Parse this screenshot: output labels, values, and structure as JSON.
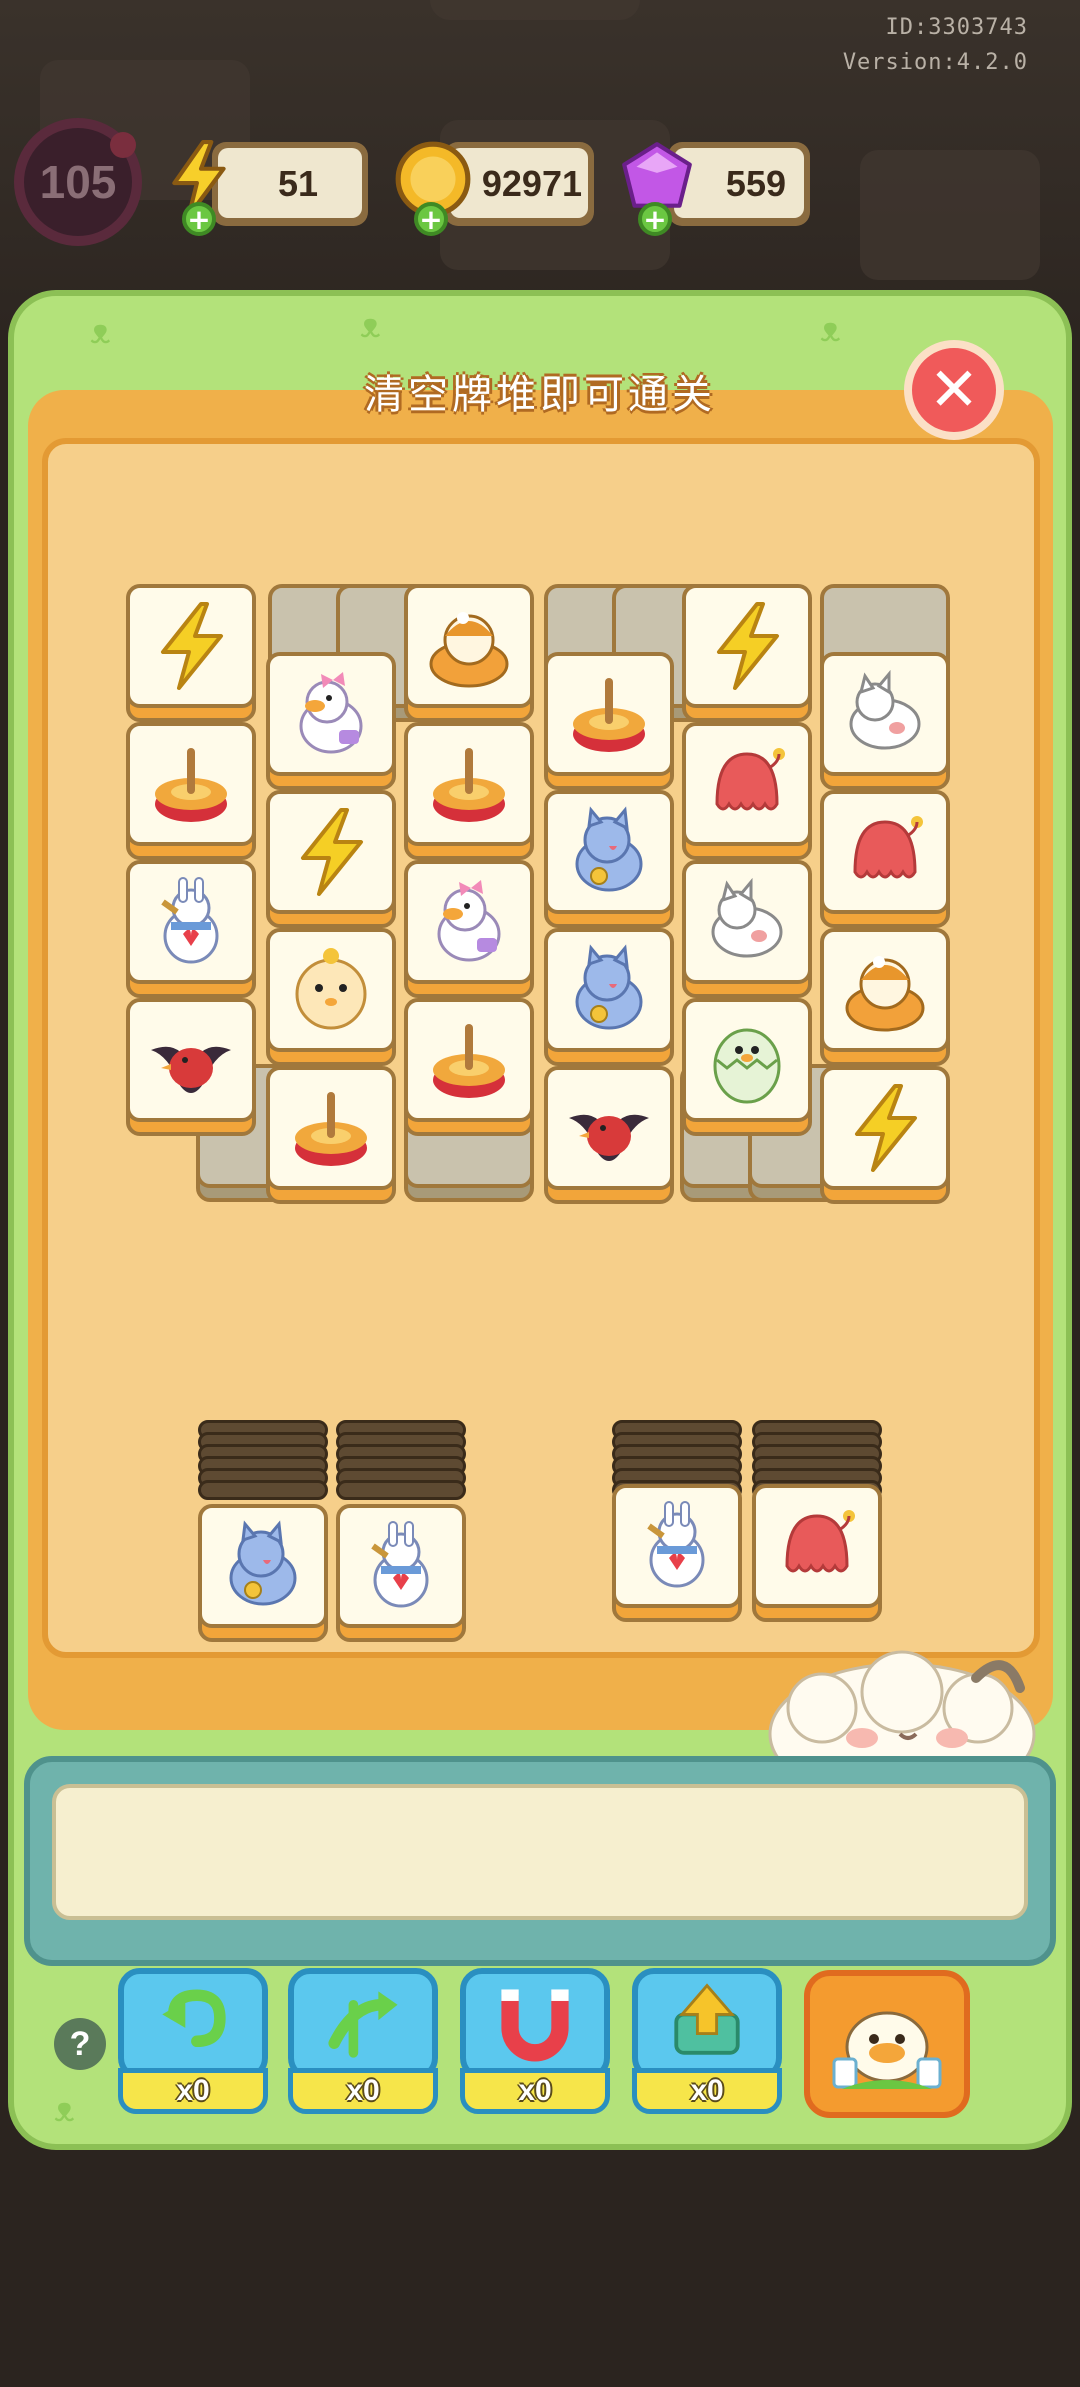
{
  "meta": {
    "id": "ID:3303743",
    "version": "Version:4.2.0"
  },
  "hud": {
    "level": "105",
    "energy": {
      "value": "51",
      "icon": "lightning-bolt-icon"
    },
    "coins": {
      "value": "92971",
      "icon": "coin-icon"
    },
    "gems": {
      "value": "559",
      "icon": "purple-gem-icon"
    }
  },
  "board": {
    "title": "清空牌堆即可通关",
    "close_icon": "close-icon"
  },
  "tiles": [
    {
      "icon": "lightning-icon",
      "dim": false
    },
    {
      "icon": "duck-bow-icon",
      "dim": false
    },
    {
      "icon": "bun-cat-icon",
      "dim": false
    },
    {
      "icon": "spinning-top-icon",
      "dim": false
    },
    {
      "icon": "lightning-icon",
      "dim": false
    },
    {
      "icon": "white-cat-icon",
      "dim": false
    },
    {
      "icon": "spinning-top-icon",
      "dim": false
    },
    {
      "icon": "spinning-top-icon",
      "dim": false
    },
    {
      "icon": "blue-cat-icon",
      "dim": false
    },
    {
      "icon": "red-octopus-icon",
      "dim": false
    },
    {
      "icon": "red-octopus-icon",
      "dim": false
    },
    {
      "icon": "lightning-icon",
      "dim": false
    },
    {
      "icon": "rabbit-heart-icon",
      "dim": false
    },
    {
      "icon": "duck-bow-icon",
      "dim": false
    },
    {
      "icon": "blue-cat-icon",
      "dim": false
    },
    {
      "icon": "white-cat-icon",
      "dim": false
    },
    {
      "icon": "bun-cat-icon",
      "dim": false
    },
    {
      "icon": "pufferfish-icon",
      "dim": false
    },
    {
      "icon": "red-bird-icon",
      "dim": false
    },
    {
      "icon": "spinning-top-icon",
      "dim": false
    },
    {
      "icon": "egg-chick-icon",
      "dim": false
    },
    {
      "icon": "spinning-top-icon",
      "dim": false
    },
    {
      "icon": "red-bird-icon",
      "dim": false
    },
    {
      "icon": "lightning-icon",
      "dim": false
    }
  ],
  "stacks": [
    {
      "icon": "blue-cat-icon"
    },
    {
      "icon": "rabbit-heart-icon"
    },
    {
      "icon": "rabbit-heart-icon"
    },
    {
      "icon": "red-octopus-icon"
    }
  ],
  "tools": [
    {
      "icon": "undo-arrow-icon",
      "count": "x0",
      "name": "undo"
    },
    {
      "icon": "shuffle-arrow-icon",
      "count": "x0",
      "name": "move-out"
    },
    {
      "icon": "magnet-icon",
      "count": "x0",
      "name": "magnet"
    },
    {
      "icon": "up-arrow-box-icon",
      "count": "x0",
      "name": "remove"
    }
  ],
  "help": "?",
  "colors": {
    "panel": "#b3e27a",
    "board": "#f0b04a",
    "tray": "#6fb3ac",
    "tool": "#5bc8ee"
  }
}
